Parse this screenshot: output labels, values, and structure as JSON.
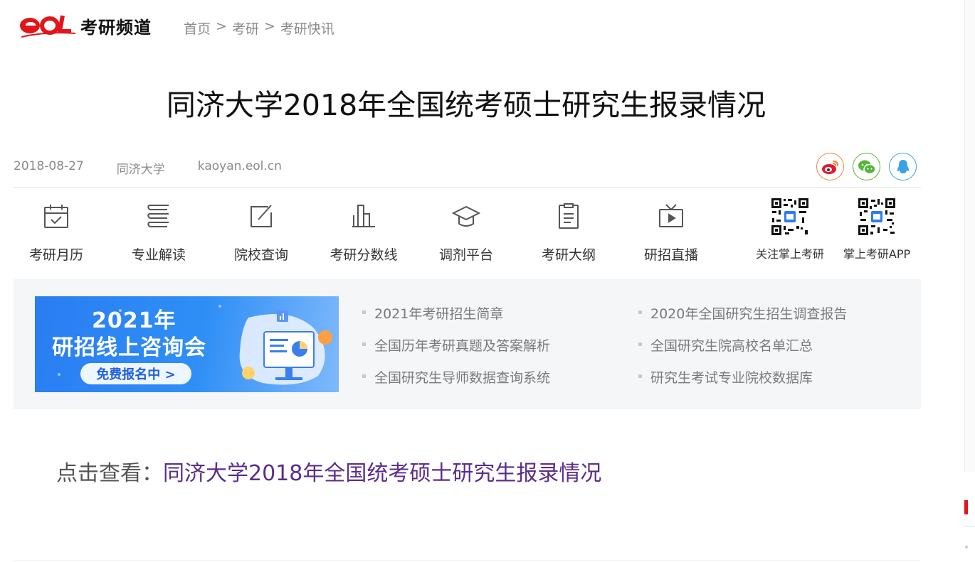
{
  "header": {
    "logo_title": "考研频道",
    "breadcrumb": [
      "首页",
      ">",
      "考研",
      ">",
      "考研快讯"
    ]
  },
  "article": {
    "title": "同济大学2018年全国统考硕士研究生报录情况",
    "date": "2018-08-27",
    "source": "同济大学",
    "site": "kaoyan.eol.cn"
  },
  "share": [
    {
      "icon": "weibo-icon",
      "color": "#f0823a"
    },
    {
      "icon": "wechat-icon",
      "color": "#56b53b"
    },
    {
      "icon": "qq-icon",
      "color": "#3aa2e6"
    }
  ],
  "tools": [
    {
      "label": "考研月历",
      "icon": "calendar-icon"
    },
    {
      "label": "专业解读",
      "icon": "layers-icon"
    },
    {
      "label": "院校查询",
      "icon": "edit-icon"
    },
    {
      "label": "考研分数线",
      "icon": "bar-chart-icon"
    },
    {
      "label": "调剂平台",
      "icon": "graduation-cap-icon"
    },
    {
      "label": "考研大纲",
      "icon": "document-icon"
    },
    {
      "label": "研招直播",
      "icon": "tv-icon"
    },
    {
      "label": "关注掌上考研",
      "icon": "qr-code-icon"
    },
    {
      "label": "掌上考研APP",
      "icon": "qr-code-icon"
    }
  ],
  "banner": {
    "year": "2021年",
    "subtitle": "研招线上咨询会",
    "cta": "免费报名中 >"
  },
  "links": [
    "2021年考研招生简章",
    "2020年全国研究生招生调查报告",
    "全国历年考研真题及答案解析",
    "全国研究生院高校名单汇总",
    "全国研究生导师数据查询系统",
    "研究生考试专业院校数据库"
  ],
  "click_view": {
    "prefix": "点击查看：",
    "link": "同济大学2018年全国统考硕士研究生报录情况"
  },
  "colors": {
    "brand_red": "#e0161a",
    "link_purple": "#5b2d8a",
    "banner_blue": "#2a7df2"
  }
}
